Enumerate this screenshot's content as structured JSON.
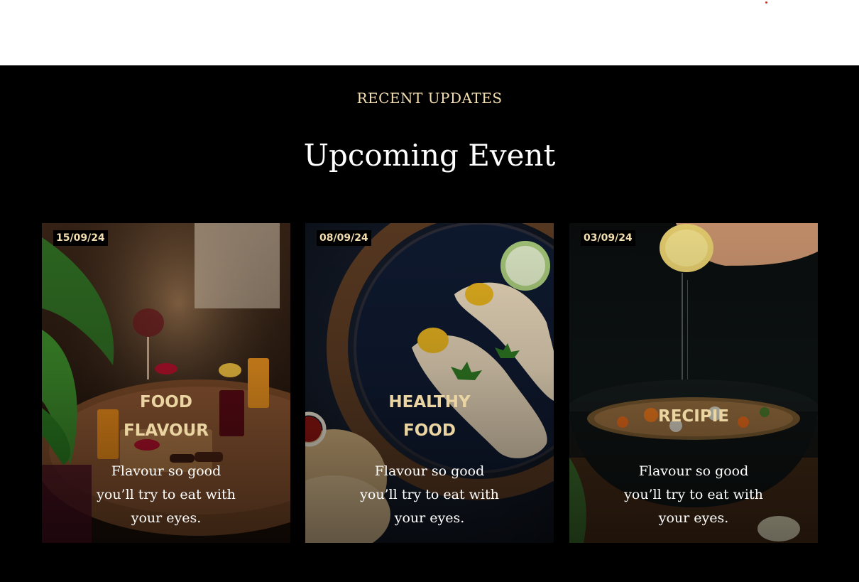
{
  "section": {
    "eyebrow": "RECENT UPDATES",
    "heading": "Upcoming Event"
  },
  "cards": [
    {
      "date": "15/09/24",
      "title_line1": "FOOD",
      "title_line2": "FLAVOUR",
      "description": "Flavour so good you’ll try to eat with your eyes."
    },
    {
      "date": "08/09/24",
      "title_line1": "HEALTHY",
      "title_line2": "FOOD",
      "description": "Flavour so good you’ll try to eat with your eyes."
    },
    {
      "date": "03/09/24",
      "title_line1": "RECIPIE",
      "title_line2": "",
      "description": "Flavour so good you’ll try to eat with your eyes."
    }
  ],
  "colors": {
    "accent_gold": "#f3deb0",
    "background": "#000000",
    "header_background": "#ffffff"
  }
}
